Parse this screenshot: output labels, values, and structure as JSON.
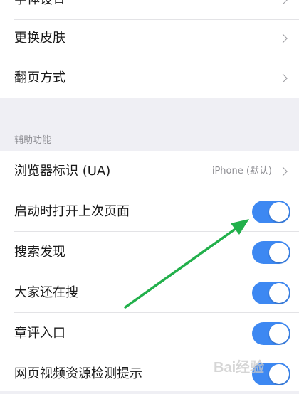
{
  "group_top": {
    "items": [
      {
        "label": "字体设置"
      },
      {
        "label": "更换皮肤"
      },
      {
        "label": "翻页方式"
      }
    ]
  },
  "aux": {
    "section_title": "辅助功能",
    "browser_ua": {
      "label": "浏览器标识 (UA)",
      "value": "iPhone (默认)"
    },
    "toggles": [
      {
        "label": "启动时打开上次页面",
        "on": true
      },
      {
        "label": "搜索发现",
        "on": true
      },
      {
        "label": "大家还在搜",
        "on": true
      },
      {
        "label": "章评入口",
        "on": true
      },
      {
        "label": "网页视频资源检测提示",
        "on": true
      }
    ]
  },
  "colors": {
    "toggle_on": "#3d88f2",
    "arrow": "#22b04b"
  },
  "watermark": {
    "text": "Bai经验"
  }
}
